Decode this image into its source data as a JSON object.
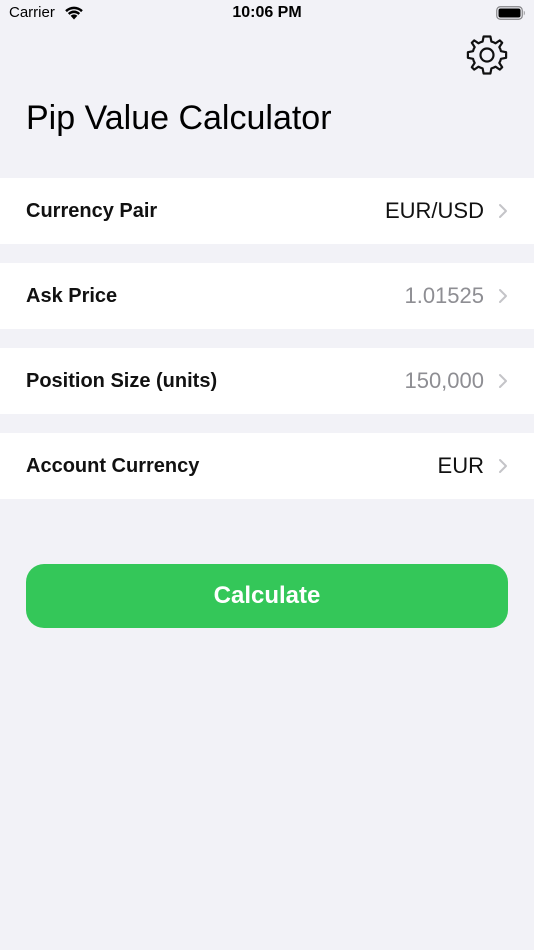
{
  "status_bar": {
    "carrier": "Carrier",
    "time": "10:06 PM"
  },
  "header": {
    "title": "Pip Value Calculator",
    "settings_icon": "gear-icon"
  },
  "rows": [
    {
      "label": "Currency Pair",
      "value": "EUR/USD",
      "value_style": "dark"
    },
    {
      "label": "Ask Price",
      "value": "1.01525",
      "value_style": "muted"
    },
    {
      "label": "Position Size (units)",
      "value": "150,000",
      "value_style": "muted"
    },
    {
      "label": "Account Currency",
      "value": "EUR",
      "value_style": "dark"
    }
  ],
  "actions": {
    "calculate_label": "Calculate"
  },
  "colors": {
    "background": "#f2f2f7",
    "accent": "#34c759",
    "muted_text": "#8e8e93"
  }
}
